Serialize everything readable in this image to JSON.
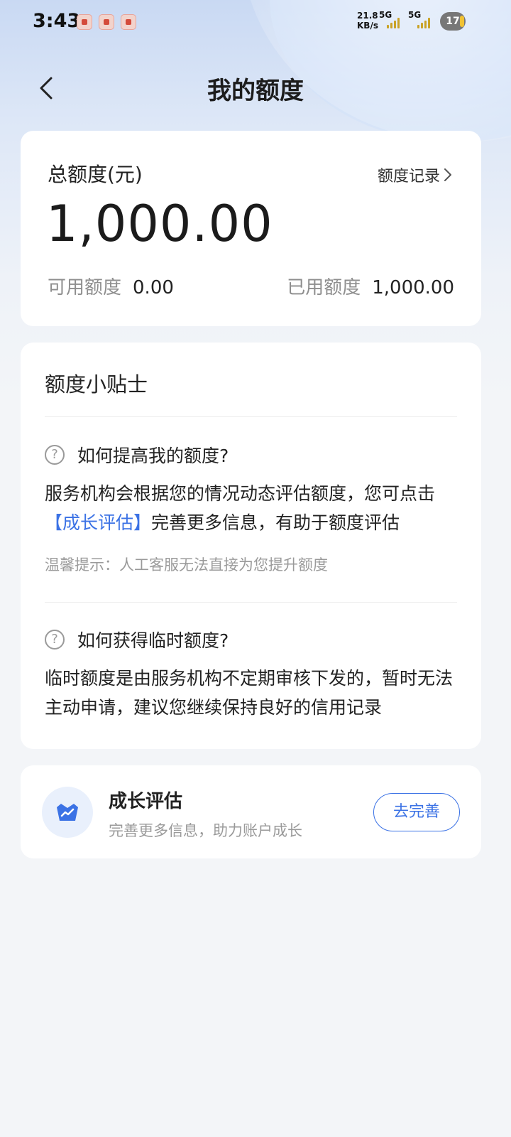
{
  "status_bar": {
    "time": "3:43",
    "net_speed_value": "21.8",
    "net_speed_unit": "KB/s",
    "sim1": "5G",
    "sim2": "5G",
    "battery": "17",
    "icons": [
      "app-notification-icon",
      "app-notification-icon",
      "app-notification-icon"
    ]
  },
  "header": {
    "title": "我的额度"
  },
  "quota_card": {
    "label": "总额度(元)",
    "record_link": "额度记录",
    "total": "1,000.00",
    "available_label": "可用额度",
    "available_value": "0.00",
    "used_label": "已用额度",
    "used_value": "1,000.00"
  },
  "tips_card": {
    "title": "额度小贴士",
    "q1": "如何提高我的额度?",
    "a1_prefix": "服务机构会根据您的情况动态评估额度，您可点击",
    "a1_link": "【成长评估】",
    "a1_suffix": "完善更多信息，有助于额度评估",
    "hint": "温馨提示：人工客服无法直接为您提升额度",
    "q2": "如何获得临时额度?",
    "a2": "临时额度是由服务机构不定期审核下发的，暂时无法主动申请，建议您继续保持良好的信用记录"
  },
  "growth_card": {
    "title": "成长评估",
    "subtitle": "完善更多信息，助力账户成长",
    "button": "去完善"
  },
  "colors": {
    "accent": "#3b72e5",
    "background": "#f3f5f8"
  }
}
